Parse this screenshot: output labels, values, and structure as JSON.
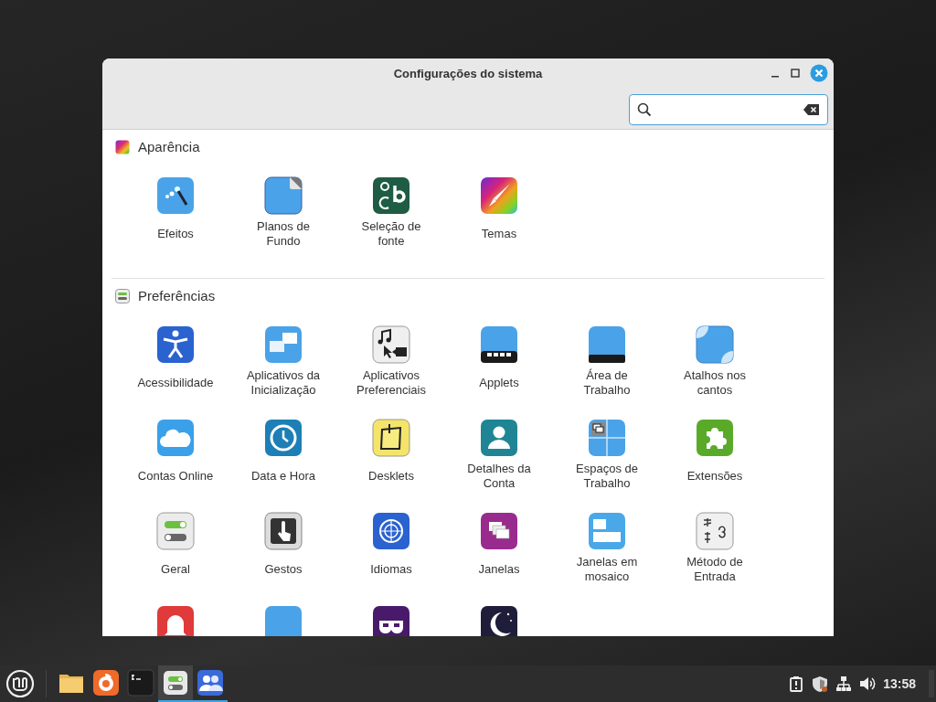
{
  "window": {
    "title": "Configurações do sistema"
  },
  "search": {
    "focused": true
  },
  "sections": [
    {
      "title": "Aparência",
      "kind": "appearance",
      "items": [
        {
          "label": "Efeitos",
          "kind": "effects"
        },
        {
          "label": "Planos de Fundo",
          "kind": "wallpaper"
        },
        {
          "label": "Seleção de fonte",
          "kind": "font"
        },
        {
          "label": "Temas",
          "kind": "themes"
        }
      ]
    },
    {
      "title": "Preferências",
      "kind": "preferences",
      "items": [
        {
          "label": "Acessibilidade",
          "kind": "accessibility"
        },
        {
          "label": "Aplicativos da Inicialização",
          "kind": "startup"
        },
        {
          "label": "Aplicativos Preferenciais",
          "kind": "preferred"
        },
        {
          "label": "Applets",
          "kind": "applets"
        },
        {
          "label": "Área de Trabalho",
          "kind": "desktop"
        },
        {
          "label": "Atalhos nos cantos",
          "kind": "corners"
        },
        {
          "label": "Contas Online",
          "kind": "online"
        },
        {
          "label": "Data e Hora",
          "kind": "datetime"
        },
        {
          "label": "Desklets",
          "kind": "desklets"
        },
        {
          "label": "Detalhes da Conta",
          "kind": "account"
        },
        {
          "label": "Espaços de Trabalho",
          "kind": "workspaces"
        },
        {
          "label": "Extensões",
          "kind": "extensions"
        },
        {
          "label": "Geral",
          "kind": "general"
        },
        {
          "label": "Gestos",
          "kind": "gestures"
        },
        {
          "label": "Idiomas",
          "kind": "languages"
        },
        {
          "label": "Janelas",
          "kind": "windows"
        },
        {
          "label": "Janelas em mosaico",
          "kind": "tiling"
        },
        {
          "label": "Método de Entrada",
          "kind": "input"
        },
        {
          "kind": "notifications"
        },
        {
          "kind": "panel"
        },
        {
          "kind": "privacy"
        },
        {
          "kind": "screensaver"
        }
      ]
    }
  ],
  "taskbar": {
    "apps": [
      {
        "kind": "files",
        "selected": false,
        "running": false
      },
      {
        "kind": "browser",
        "selected": false,
        "running": false
      },
      {
        "kind": "terminal",
        "selected": false,
        "running": false
      },
      {
        "kind": "settings",
        "selected": true,
        "running": true
      },
      {
        "kind": "users",
        "selected": false,
        "running": true
      }
    ],
    "tray": [
      {
        "kind": "updates"
      },
      {
        "kind": "shield"
      },
      {
        "kind": "network"
      },
      {
        "kind": "volume"
      }
    ],
    "clock": "13:58"
  }
}
